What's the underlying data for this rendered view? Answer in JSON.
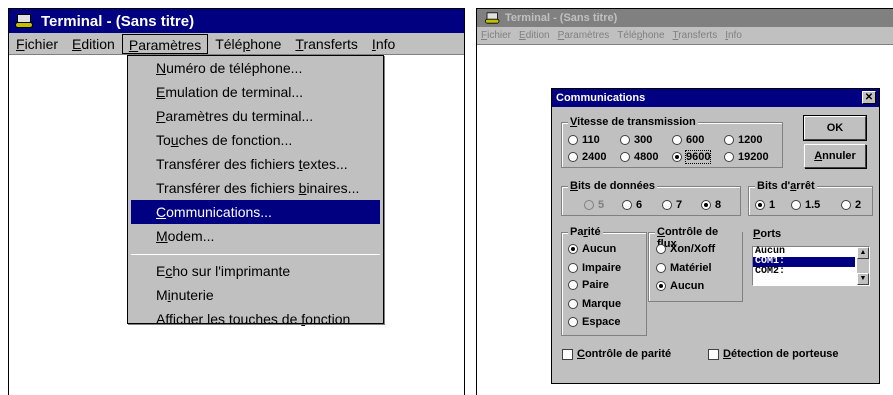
{
  "left_window": {
    "title": "Terminal - (Sans titre)",
    "menu": [
      "Fichier",
      "Edition",
      "Paramètres",
      "Téléphone",
      "Transferts",
      "Info"
    ],
    "open_menu_index": 2,
    "dropdown_items": [
      "Numéro de téléphone...",
      "Emulation de terminal...",
      "Paramètres du terminal...",
      "Touches de fonction...",
      "Transférer des fichiers textes...",
      "Transférer des fichiers binaires...",
      "Communications...",
      "Modem...",
      "Echo sur l'imprimante",
      "Minuterie",
      "Afficher les touches de fonction"
    ],
    "highlighted_item": "Communications..."
  },
  "right_window": {
    "title": "Terminal - (Sans titre)",
    "menu": [
      "Fichier",
      "Edition",
      "Paramètres",
      "Téléphone",
      "Transferts",
      "Info"
    ]
  },
  "dialog": {
    "title": "Communications",
    "close": "✕",
    "ok_label": "OK",
    "cancel_label": "Annuler",
    "baud": {
      "label": "Vitesse de transmission",
      "options": [
        "110",
        "300",
        "600",
        "1200",
        "2400",
        "4800",
        "9600",
        "19200"
      ],
      "selected": "9600"
    },
    "data_bits": {
      "label": "Bits de données",
      "options": [
        "5",
        "6",
        "7",
        "8"
      ],
      "selected": "8"
    },
    "stop_bits": {
      "label": "Bits d'arrêt",
      "options": [
        "1",
        "1.5",
        "2"
      ],
      "selected": "1"
    },
    "parity": {
      "label": "Parité",
      "options": [
        "Aucun",
        "Impaire",
        "Paire",
        "Marque",
        "Espace"
      ],
      "selected": "Aucun"
    },
    "flow": {
      "label": "Contrôle de flux",
      "options": [
        "Xon/Xoff",
        "Matériel",
        "Aucun"
      ],
      "selected": "Aucun"
    },
    "ports": {
      "label": "Ports",
      "items": [
        "Aucun",
        "COM1:",
        "COM2:"
      ],
      "selected": "COM1:"
    },
    "parity_check_label": "Contrôle de parité",
    "carrier_detect_label": "Détection de porteuse"
  },
  "colors": {
    "titlebar_active": "#000080",
    "titlebar_inactive": "#808080",
    "face": "#c0c0c0",
    "highlight": "#000080"
  }
}
